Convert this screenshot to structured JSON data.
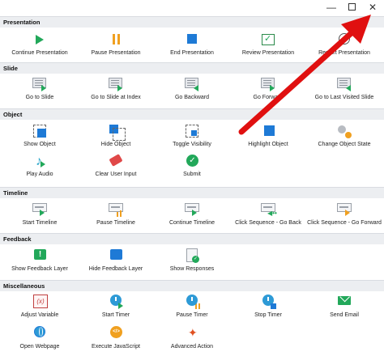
{
  "window": {
    "minimize": "—",
    "maximize": "",
    "close": "✕"
  },
  "sections": [
    {
      "title": "Presentation",
      "items": [
        {
          "label": "Continue Presentation",
          "icon": "play-icon"
        },
        {
          "label": "Pause Presentation",
          "icon": "pause-icon"
        },
        {
          "label": "End Presentation",
          "icon": "stop-icon"
        },
        {
          "label": "Review Presentation",
          "icon": "review-icon"
        },
        {
          "label": "Restart Presentation",
          "icon": "restart-icon"
        }
      ]
    },
    {
      "title": "Slide",
      "items": [
        {
          "label": "Go to Slide",
          "icon": "go-to-slide-icon"
        },
        {
          "label": "Go to Slide at Index",
          "icon": "go-to-slide-index-icon"
        },
        {
          "label": "Go Backward",
          "icon": "go-backward-icon"
        },
        {
          "label": "Go Forward",
          "icon": "go-forward-icon"
        },
        {
          "label": "Go to Last Visited Slide",
          "icon": "last-visited-icon"
        }
      ]
    },
    {
      "title": "Object",
      "items": [
        {
          "label": "Show Object",
          "icon": "show-object-icon"
        },
        {
          "label": "Hide Object",
          "icon": "hide-object-icon"
        },
        {
          "label": "Toggle Visibility",
          "icon": "toggle-visibility-icon"
        },
        {
          "label": "Highlight Object",
          "icon": "highlight-object-icon"
        },
        {
          "label": "Change Object State",
          "icon": "change-state-icon"
        },
        {
          "label": "Play Audio",
          "icon": "audio-icon"
        },
        {
          "label": "Clear User Input",
          "icon": "eraser-icon"
        },
        {
          "label": "Submit",
          "icon": "submit-icon"
        }
      ]
    },
    {
      "title": "Timeline",
      "items": [
        {
          "label": "Start Timeline",
          "icon": "start-timeline-icon"
        },
        {
          "label": "Pause Timeline",
          "icon": "pause-timeline-icon"
        },
        {
          "label": "Continue Timeline",
          "icon": "continue-timeline-icon"
        },
        {
          "label": "Click Sequence - Go Back",
          "icon": "sequence-back-icon"
        },
        {
          "label": "Click Sequence - Go Forward",
          "icon": "sequence-forward-icon"
        }
      ]
    },
    {
      "title": "Feedback",
      "items": [
        {
          "label": "Show Feedback Layer",
          "icon": "show-feedback-icon"
        },
        {
          "label": "Hide Feedback Layer",
          "icon": "hide-feedback-icon"
        },
        {
          "label": "Show Responses",
          "icon": "show-responses-icon"
        }
      ]
    },
    {
      "title": "Miscellaneous",
      "items": [
        {
          "label": "Adjust Variable",
          "icon": "variable-icon"
        },
        {
          "label": "Start Timer",
          "icon": "start-timer-icon"
        },
        {
          "label": "Pause Timer",
          "icon": "pause-timer-icon"
        },
        {
          "label": "Stop Timer",
          "icon": "stop-timer-icon"
        },
        {
          "label": "Send Email",
          "icon": "email-icon"
        },
        {
          "label": "Open Webpage",
          "icon": "globe-icon"
        },
        {
          "label": "Execute JavaScript",
          "icon": "javascript-icon"
        },
        {
          "label": "Advanced Action",
          "icon": "advanced-action-icon"
        }
      ]
    }
  ],
  "colors": {
    "accent_green": "#22a85a",
    "accent_orange": "#f0a020",
    "accent_blue": "#1e7ad6",
    "annotation_arrow": "#e01010"
  }
}
